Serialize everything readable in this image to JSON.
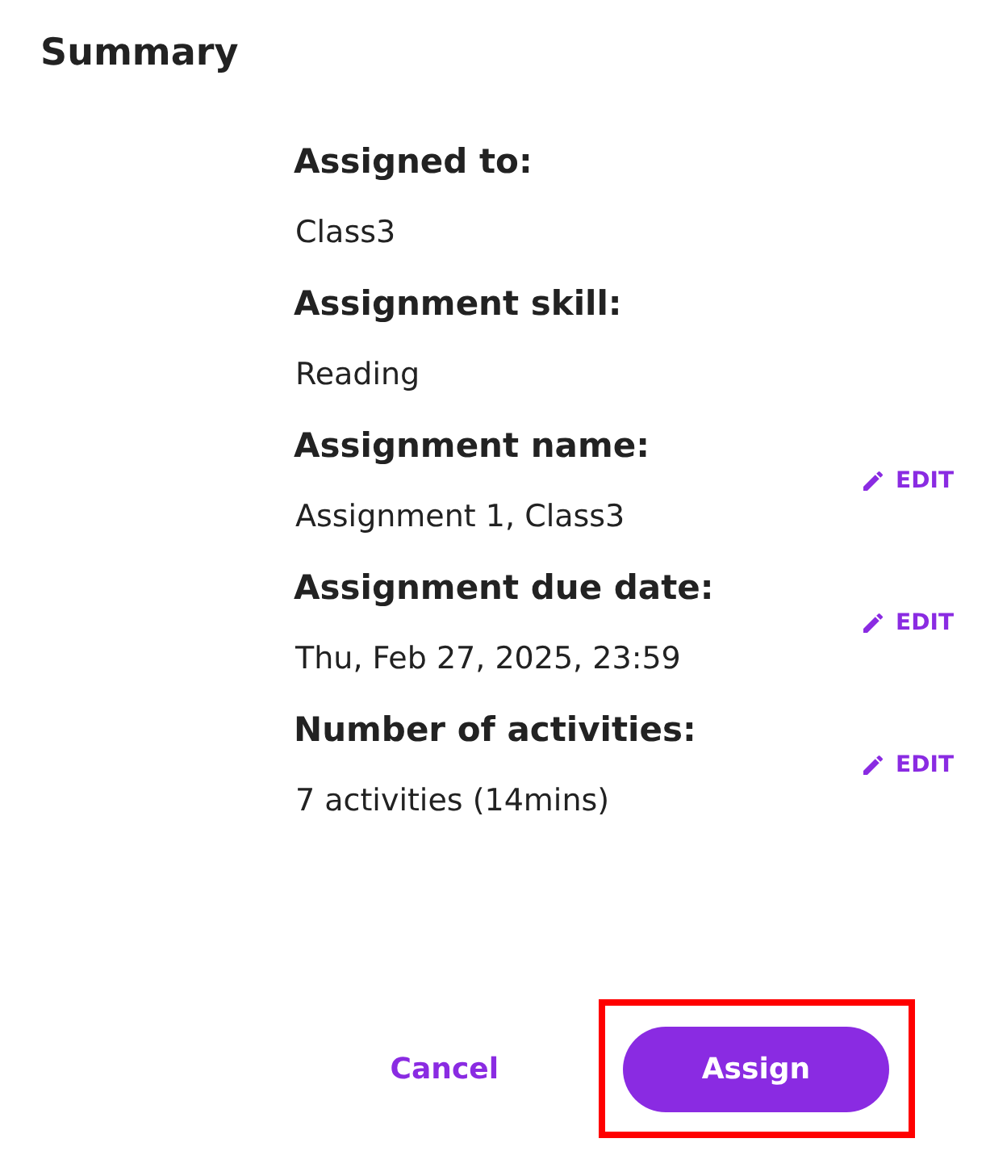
{
  "title": "Summary",
  "fields": [
    {
      "label": "Assigned to:",
      "value": "Class3",
      "editable": false
    },
    {
      "label": "Assignment skill:",
      "value": "Reading",
      "editable": false
    },
    {
      "label": "Assignment name:",
      "value": "Assignment 1, Class3",
      "editable": true,
      "edit_label": "EDIT"
    },
    {
      "label": "Assignment due date:",
      "value": "Thu, Feb 27, 2025, 23:59",
      "editable": true,
      "edit_label": "EDIT"
    },
    {
      "label": "Number of activities:",
      "value": "7 activities (14mins)",
      "editable": true,
      "edit_label": "EDIT"
    }
  ],
  "buttons": [
    {
      "label": "Cancel",
      "kind": "text",
      "highlighted": false
    },
    {
      "label": "Assign",
      "kind": "primary",
      "highlighted": true
    }
  ]
}
